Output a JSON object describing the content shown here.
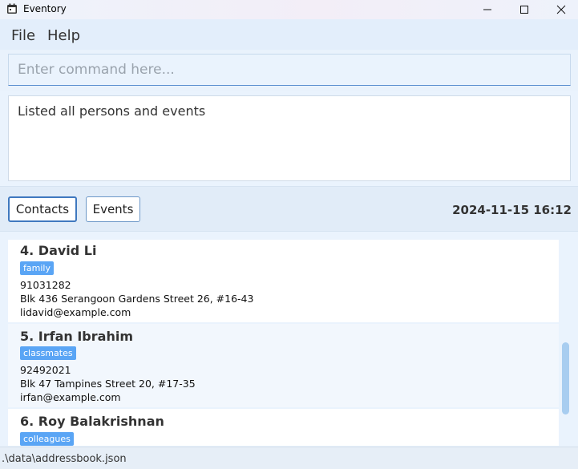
{
  "window": {
    "title": "Eventory",
    "controls": {
      "minimize": "minimize-icon",
      "maximize": "maximize-icon",
      "close": "close-icon"
    }
  },
  "menu": {
    "file": "File",
    "help": "Help"
  },
  "command": {
    "placeholder": "Enter command here...",
    "value": ""
  },
  "result": {
    "text": "Listed all persons and events"
  },
  "tabs": {
    "contacts": "Contacts",
    "events": "Events",
    "active": "Contacts"
  },
  "datetime": "2024-11-15 16:12",
  "contacts": [
    {
      "name": "4. David Li",
      "tag": "family",
      "phone": "91031282",
      "address": "Blk 436 Serangoon Gardens Street 26, #16-43",
      "email": "lidavid@example.com"
    },
    {
      "name": "5. Irfan Ibrahim",
      "tag": "classmates",
      "phone": "92492021",
      "address": "Blk 47 Tampines Street 20, #17-35",
      "email": "irfan@example.com"
    },
    {
      "name": "6. Roy Balakrishnan",
      "tag": "colleagues"
    }
  ],
  "status": {
    "path": ".\\data\\addressbook.json"
  },
  "colors": {
    "accent": "#3f78bf",
    "tag": "#5aa5f5",
    "background": "#eaf3fd"
  }
}
